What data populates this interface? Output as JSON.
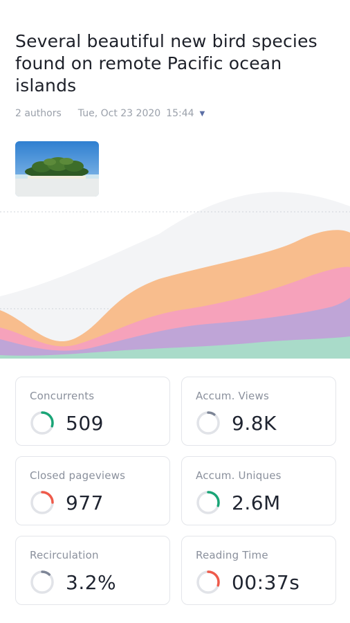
{
  "article": {
    "title": "Several beautiful new bird species found on remote Pacific ocean islands",
    "authors": "2 authors",
    "date": "Tue, Oct 23 2020",
    "time": "15:44"
  },
  "colors": {
    "ring_green": "#1aa577",
    "ring_red": "#ef5a4a",
    "ring_gray": "#7d8596",
    "ring_track": "#e1e3e8",
    "area_peach": "#f8bd8d",
    "area_pink": "#f6a2bb",
    "area_purple": "#bfa5d7",
    "area_mint": "#a9dbc9"
  },
  "metrics": [
    {
      "label": "Concurrents",
      "value": "509",
      "ring_color": "green",
      "ring_fraction": 0.3
    },
    {
      "label": "Accum. Views",
      "value": "9.8K",
      "ring_color": "gray",
      "ring_fraction": 0.1
    },
    {
      "label": "Closed pageviews",
      "value": "977",
      "ring_color": "red",
      "ring_fraction": 0.25
    },
    {
      "label": "Accum. Uniques",
      "value": "2.6M",
      "ring_color": "green",
      "ring_fraction": 0.3
    },
    {
      "label": "Recirculation",
      "value": "3.2%",
      "ring_color": "gray",
      "ring_fraction": 0.12
    },
    {
      "label": "Reading Time",
      "value": "00:37s",
      "ring_color": "red",
      "ring_fraction": 0.3
    }
  ]
}
